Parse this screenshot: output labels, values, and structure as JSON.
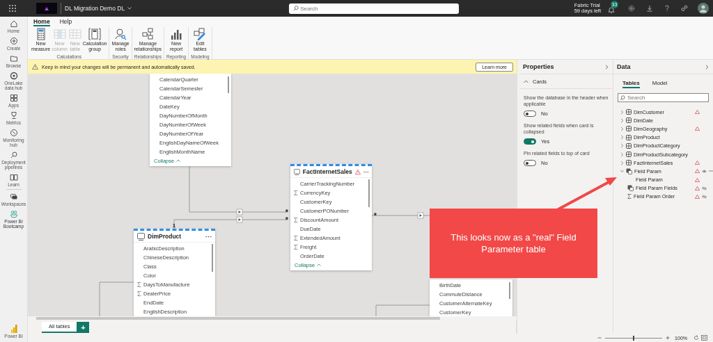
{
  "top_bar": {
    "workspace": "DL Migration Demo DL",
    "search_placeholder": "Search",
    "trial_name": "Fabric Trial",
    "trial_days": "59 days left",
    "notification_count": "33"
  },
  "nav": [
    {
      "label": "Home",
      "selected": false
    },
    {
      "label": "Create",
      "selected": false
    },
    {
      "label": "Browse",
      "selected": false
    },
    {
      "label": "OneLake data hub",
      "selected": false
    },
    {
      "label": "Apps",
      "selected": false
    },
    {
      "label": "Metrics",
      "selected": false
    },
    {
      "label": "Monitoring hub",
      "selected": false
    },
    {
      "label": "Deployment pipelines",
      "selected": false
    },
    {
      "label": "Learn",
      "selected": false
    },
    {
      "label": "Workspaces",
      "selected": false
    },
    {
      "label": "Power BI Bootcamp",
      "selected": true
    }
  ],
  "nav_footer": "Power BI",
  "ribbon": {
    "tabs": [
      {
        "label": "Home",
        "selected": true
      },
      {
        "label": "Help",
        "selected": false
      }
    ],
    "groups": [
      {
        "label": "Calculations",
        "buttons": [
          {
            "label": "New measure",
            "disabled": false
          },
          {
            "label": "New column",
            "disabled": true
          },
          {
            "label": "New table",
            "disabled": true
          },
          {
            "label": "Calculation group",
            "disabled": false
          }
        ]
      },
      {
        "label": "Security",
        "buttons": [
          {
            "label": "Manage roles",
            "disabled": false
          }
        ]
      },
      {
        "label": "Relationships",
        "buttons": [
          {
            "label": "Manage relationships",
            "disabled": false
          }
        ]
      },
      {
        "label": "Reporting",
        "buttons": [
          {
            "label": "New report",
            "disabled": false
          }
        ]
      },
      {
        "label": "Modeling",
        "buttons": [
          {
            "label": "Edit tables",
            "disabled": false
          }
        ]
      }
    ]
  },
  "banner": {
    "message": "Keep in mind your changes will be permanent and automatically saved.",
    "button": "Learn more"
  },
  "canvas_tables": [
    {
      "collapse": "Collapse",
      "fields": [
        {
          "name": "CalendarQuarter",
          "kind": "plain"
        },
        {
          "name": "CalendarSemester",
          "kind": "plain"
        },
        {
          "name": "CalendarYear",
          "kind": "plain"
        },
        {
          "name": "DateKey",
          "kind": "plain"
        },
        {
          "name": "DayNumberOfMonth",
          "kind": "plain"
        },
        {
          "name": "DayNumberOfWeek",
          "kind": "plain"
        },
        {
          "name": "DayNumberOfYear",
          "kind": "plain"
        },
        {
          "name": "EnglishDayNameOfWeek",
          "kind": "plain"
        },
        {
          "name": "EnglishMonthName",
          "kind": "plain"
        }
      ]
    },
    {
      "title": "FactInternetSales",
      "warning": true,
      "collapse": "Collapse",
      "fields": [
        {
          "name": "CarrierTrackingNumber",
          "kind": "plain"
        },
        {
          "name": "CurrencyKey",
          "kind": "sum"
        },
        {
          "name": "CustomerKey",
          "kind": "plain"
        },
        {
          "name": "CustomerPONumber",
          "kind": "plain"
        },
        {
          "name": "DiscountAmount",
          "kind": "sum"
        },
        {
          "name": "DueDate",
          "kind": "plain"
        },
        {
          "name": "ExtendedAmount",
          "kind": "sum"
        },
        {
          "name": "Freight",
          "kind": "sum"
        },
        {
          "name": "OrderDate",
          "kind": "plain"
        }
      ]
    },
    {
      "title": "DimProduct",
      "fields": [
        {
          "name": "ArabicDescription",
          "kind": "plain"
        },
        {
          "name": "ChineseDescription",
          "kind": "plain"
        },
        {
          "name": "Class",
          "kind": "plain"
        },
        {
          "name": "Color",
          "kind": "plain"
        },
        {
          "name": "DaysToManufacture",
          "kind": "sum"
        },
        {
          "name": "DealerPrice",
          "kind": "sum"
        },
        {
          "name": "EndDate",
          "kind": "plain"
        },
        {
          "name": "EnglishDescription",
          "kind": "plain"
        }
      ]
    },
    {
      "fields": [
        {
          "name": "BirthDate",
          "kind": "plain"
        },
        {
          "name": "CommuteDistance",
          "kind": "plain"
        },
        {
          "name": "CustomerAlternateKey",
          "kind": "plain"
        },
        {
          "name": "CustomerKey",
          "kind": "plain"
        }
      ]
    }
  ],
  "relationships": [
    {
      "many": "*"
    },
    {
      "one": "1",
      "many": "*"
    },
    {
      "many": "*"
    }
  ],
  "bottom_tabs": [
    {
      "label": "All tables",
      "selected": true
    }
  ],
  "add_tab": "+",
  "status": {
    "zoom": "100%",
    "level": 0.5
  },
  "properties": {
    "title": "Properties",
    "section": "Cards",
    "expanded": true,
    "settings": [
      {
        "label": "Show the database in the header when applicable",
        "on": false,
        "state_text": "No"
      },
      {
        "label": "Show related fields when card is collapsed",
        "on": true,
        "state_text": "Yes"
      },
      {
        "label": "Pin related fields to top of card",
        "on": false,
        "state_text": "No"
      }
    ]
  },
  "data": {
    "title": "Data",
    "tabs": [
      {
        "label": "Tables",
        "selected": true
      },
      {
        "label": "Model",
        "selected": false
      }
    ],
    "search_placeholder": "Search",
    "items": [
      {
        "name": "DimCustomer",
        "kind": "table",
        "warning": true,
        "expanded": false
      },
      {
        "name": "DimDate",
        "kind": "table",
        "warning": false,
        "expanded": false
      },
      {
        "name": "DimGeography",
        "kind": "table",
        "warning": true,
        "expanded": false
      },
      {
        "name": "DimProduct",
        "kind": "table",
        "warning": false,
        "expanded": false
      },
      {
        "name": "DimProductCategory",
        "kind": "table",
        "warning": false,
        "expanded": false
      },
      {
        "name": "DimProductSubcategory",
        "kind": "table",
        "warning": false,
        "expanded": false
      },
      {
        "name": "FactInternetSales",
        "kind": "table",
        "warning": true,
        "expanded": false
      },
      {
        "name": "Field Param",
        "kind": "param-table",
        "warning": true,
        "expanded": true,
        "hidden": false,
        "more": true,
        "children": [
          {
            "name": "Field Param",
            "kind": "column",
            "warning": true
          },
          {
            "name": "Field Param Fields",
            "kind": "param-field",
            "warning": true,
            "hidden": true
          },
          {
            "name": "Field Param Order",
            "kind": "sum",
            "warning": true,
            "hidden": true
          }
        ]
      }
    ]
  },
  "callout": {
    "text": "This looks now as a \"real\" Field Parameter table"
  }
}
